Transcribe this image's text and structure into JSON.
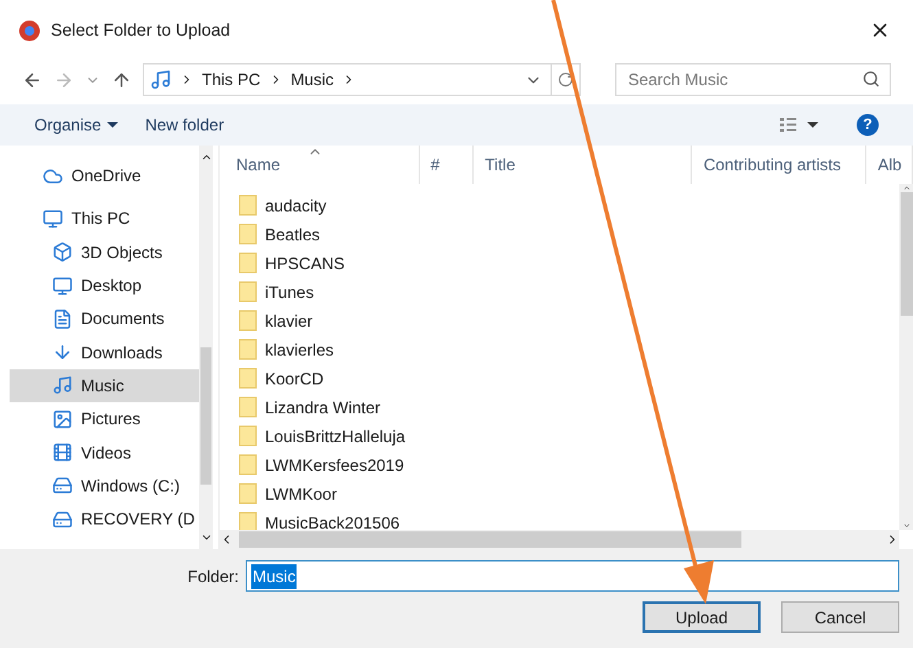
{
  "window": {
    "title": "Select Folder to Upload"
  },
  "address": {
    "crumbs": [
      "This PC",
      "Music"
    ]
  },
  "search": {
    "placeholder": "Search Music"
  },
  "toolbar": {
    "organise": "Organise",
    "new_folder": "New folder",
    "help": "?"
  },
  "sidebar": {
    "items": [
      {
        "label": "OneDrive",
        "selected": false
      },
      {
        "label": "This PC",
        "selected": false,
        "children": [
          {
            "label": "3D Objects",
            "selected": false
          },
          {
            "label": "Desktop",
            "selected": false
          },
          {
            "label": "Documents",
            "selected": false
          },
          {
            "label": "Downloads",
            "selected": false
          },
          {
            "label": "Music",
            "selected": true
          },
          {
            "label": "Pictures",
            "selected": false
          },
          {
            "label": "Videos",
            "selected": false
          },
          {
            "label": "Windows (C:)",
            "selected": false
          },
          {
            "label": "RECOVERY (D",
            "selected": false
          }
        ]
      }
    ]
  },
  "table": {
    "columns": [
      "Name",
      "#",
      "Title",
      "Contributing artists",
      "Alb"
    ],
    "rows": [
      "audacity",
      "Beatles",
      "HPSCANS",
      "iTunes",
      "klavier",
      "klavierles",
      "KoorCD",
      "Lizandra Winter",
      "LouisBrittzHalleluja",
      "LWMKersfees2019",
      "LWMKoor",
      "MusicBack201506"
    ]
  },
  "folder": {
    "label": "Folder:",
    "value": "Music"
  },
  "buttons": [
    {
      "label": "Upload",
      "default": true
    },
    {
      "label": "Cancel",
      "default": false
    }
  ]
}
